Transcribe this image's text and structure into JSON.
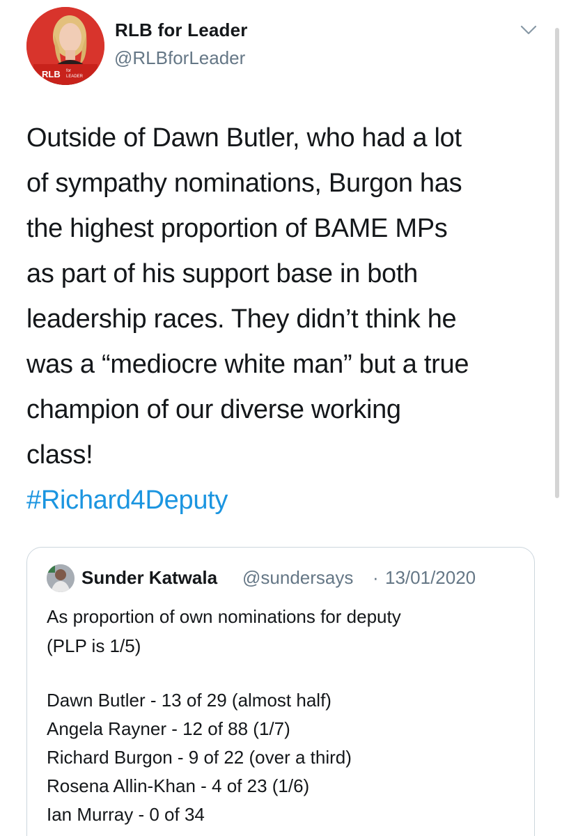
{
  "tweet": {
    "display_name": "RLB for Leader",
    "handle": "@RLBforLeader",
    "avatar_badge": {
      "main": "RLB",
      "for": "for",
      "leader": "LEADER"
    },
    "body": "Outside of Dawn Butler, who had a lot\nof sympathy nominations, Burgon has\nthe highest proportion of BAME MPs\nas part of his support base in both\nleadership races. They didn’t think he\nwas a “mediocre white man” but a true\nchampion of our diverse working\nclass!",
    "hashtag": "#Richard4Deputy",
    "menu_icon": "chevron-down-icon"
  },
  "quoted_tweet": {
    "display_name": "Sunder Katwala",
    "handle": "@sundersays",
    "separator": "·",
    "date": "13/01/2020",
    "lines": [
      "As proportion of own nominations for deputy",
      "(PLP is 1/5)",
      "",
      "Dawn Butler - 13 of 29 (almost half)",
      "Angela Rayner - 12 of 88 (1/7)",
      "Richard Burgon - 9 of 22 (over a third)",
      "Rosena Allin-Khan - 4 of 23 (1/6)",
      "Ian Murray - 0 of 34"
    ]
  },
  "colors": {
    "text": "#14171a",
    "secondary": "#657786",
    "link": "#1b95e0",
    "avatar_red": "#d8342c",
    "border": "#ccd6dd"
  }
}
